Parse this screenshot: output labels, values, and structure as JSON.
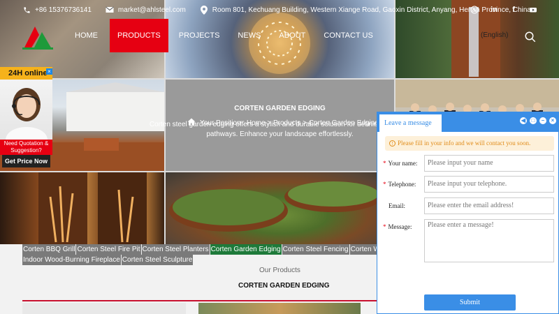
{
  "topbar": {
    "phone": "+86 15376736141",
    "email": "market@ahlsteel.com",
    "address": "Room 801, Kechuang Building, Western Xiange Road, Gaoxin District, Anyang, Henan Province, China.",
    "socials": [
      "whatsapp-icon",
      "linkedin-icon",
      "facebook-icon",
      "youtube-icon"
    ]
  },
  "nav": {
    "items": [
      "HOME",
      "PRODUCTS",
      "PROJECTS",
      "NEWS",
      "ABOUT",
      "CONTACT US"
    ],
    "active_index": 1,
    "language": "(English)"
  },
  "banner": {
    "title": "CORTEN GARDEN EDGING",
    "breadcrumb": "Your Position : Home > Products > Corten Garden Edging",
    "description_line1": "Corten steel garden edging offers a stylish and durable solution for defining",
    "description_line2": "pathways. Enhance your landscape effortlessly."
  },
  "chat_widget": {
    "online_label": "24H online",
    "close": "×",
    "need_line1": "Need Quotation &",
    "need_line2": "Suggestion?",
    "cta": "Get Price Now"
  },
  "categories": {
    "row1": [
      "Corten BBQ Grill",
      "Corten Steel Fire Pit",
      "Corten Steel Planters",
      "Corten Garden Edging",
      "Corten Steel Fencing",
      "Corten Water Fea"
    ],
    "row2": [
      "Indoor Wood-Burning Fireplace",
      "Corten Steel Sculpture"
    ],
    "active": "Corten Garden Edging"
  },
  "products": {
    "subtitle": "Our Products",
    "title": "CORTEN GARDEN EDGING"
  },
  "message_form": {
    "tab_label": "Leave a message",
    "notice": "Please fill in your info and we will contact you soon.",
    "fields": {
      "name_label": "Your name:",
      "name_placeholder": "Please input your name",
      "tel_label": "Telephone:",
      "tel_placeholder": "Please input your telephone.",
      "email_label": "Email:",
      "email_placeholder": "Please enter the email address!",
      "message_label": "Message:",
      "message_placeholder": "Please enter a message!"
    },
    "submit": "Submit"
  },
  "colors": {
    "accent_red": "#e60012",
    "panel_blue": "#3a8ee6",
    "active_green": "#1e7a3a",
    "online_yellow": "#f6b21b"
  }
}
